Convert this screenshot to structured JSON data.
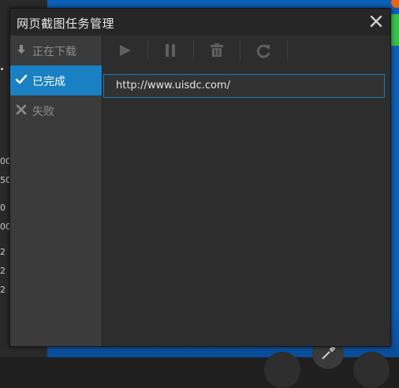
{
  "background": {
    "numbers": [
      "00",
      "50",
      "0",
      "00",
      "2",
      "2",
      "2"
    ]
  },
  "dialog": {
    "title": "网页截图任务管理",
    "close_icon": "close-icon"
  },
  "sidebar": {
    "items": [
      {
        "label": "正在下载",
        "icon": "download-icon",
        "active": false
      },
      {
        "label": "已完成",
        "icon": "check-icon",
        "active": true
      },
      {
        "label": "失败",
        "icon": "x-icon",
        "active": false
      }
    ]
  },
  "toolbar": {
    "buttons": [
      {
        "icon": "play-icon"
      },
      {
        "icon": "pause-icon"
      },
      {
        "icon": "trash-icon"
      },
      {
        "icon": "refresh-icon"
      }
    ]
  },
  "tasks": [
    {
      "url": "http://www.uisdc.com/"
    }
  ],
  "colors": {
    "accent": "#1a80c4",
    "dialog_bg": "#2d2d2d",
    "sidebar_bg": "#3b3b3b",
    "desktop_blue": "#0d5fb8"
  }
}
